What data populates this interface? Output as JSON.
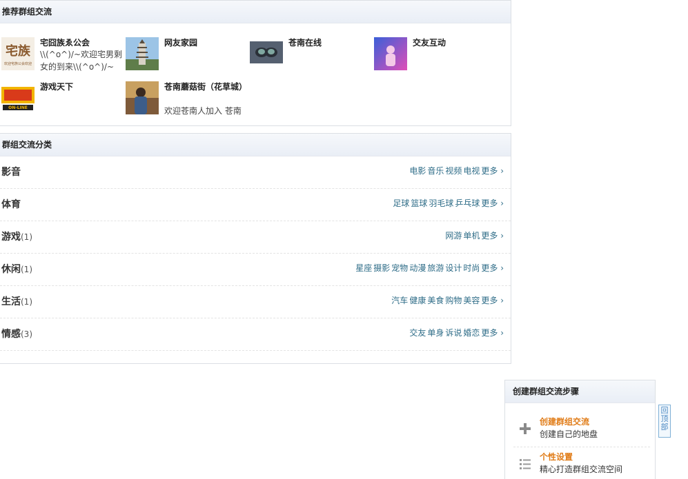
{
  "recommend": {
    "title": "推荐群组交流",
    "groups": [
      {
        "name": "宅囧族ゑ公会",
        "desc": "\\\\(^o^)/~欢迎宅男剩女的到来\\\\(^o^)/~",
        "logo_text": "宅族",
        "logo_caption": "欢迎宅族公会欢迎"
      },
      {
        "name": "网友家园",
        "desc": ""
      },
      {
        "name": "苍南在线",
        "desc": ""
      },
      {
        "name": "交友互动",
        "desc": ""
      },
      {
        "name": "游戏天下",
        "desc": "",
        "logo_text": "ON-LINE"
      },
      {
        "name": "苍南蘑菇街（花草城）",
        "desc": "欢迎苍南人加入 苍南"
      }
    ]
  },
  "categories": {
    "title": "群组交流分类",
    "more_label": "更多 ›",
    "rows": [
      {
        "name": "影音",
        "count": "",
        "links": [
          "电影",
          "音乐",
          "视频",
          "电视"
        ]
      },
      {
        "name": "体育",
        "count": "",
        "links": [
          "足球",
          "篮球",
          "羽毛球",
          "乒乓球"
        ]
      },
      {
        "name": "游戏",
        "count": "(1)",
        "links": [
          "网游",
          "单机"
        ]
      },
      {
        "name": "休闲",
        "count": "(1)",
        "links": [
          "星座",
          "摄影",
          "宠物",
          "动漫",
          "旅游",
          "设计",
          "时尚"
        ]
      },
      {
        "name": "生活",
        "count": "(1)",
        "links": [
          "汽车",
          "健康",
          "美食",
          "购物",
          "美容"
        ]
      },
      {
        "name": "情感",
        "count": "(3)",
        "links": [
          "交友",
          "单身",
          "诉说",
          "婚恋"
        ]
      }
    ]
  },
  "steps": {
    "title": "创建群组交流步骤",
    "items": [
      {
        "title": "创建群组交流",
        "desc": "创建自己的地盘",
        "icon": "plus-icon"
      },
      {
        "title": "个性设置",
        "desc": "精心打造群组交流空间",
        "icon": "list-icon"
      }
    ]
  },
  "back_top": {
    "label": "回顶部"
  },
  "colors": {
    "link": "#2f6d88",
    "step_title": "#e07b16",
    "header_bg": "#e9eef6"
  }
}
